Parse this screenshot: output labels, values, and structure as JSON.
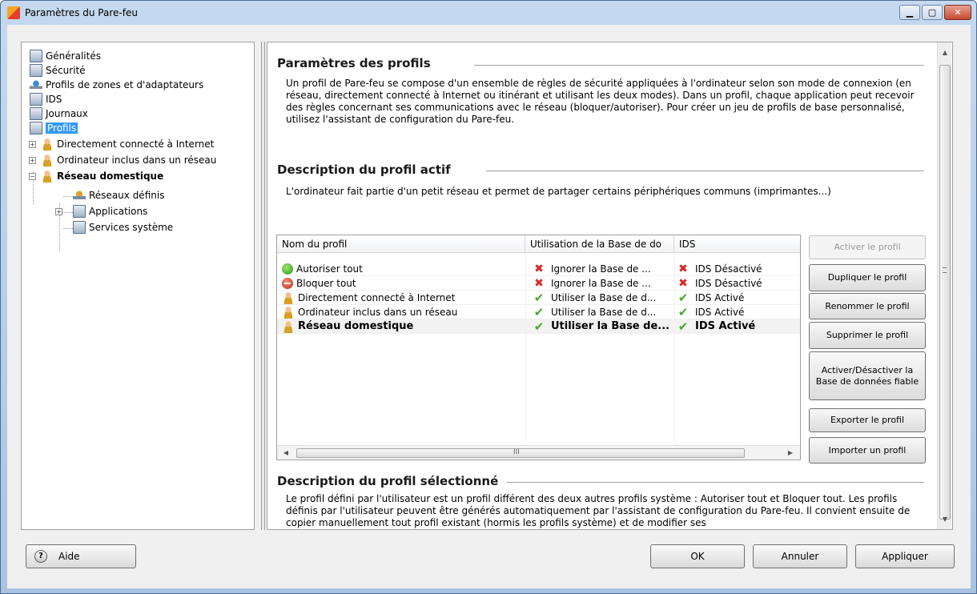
{
  "window": {
    "title": "Paramètres du Pare-feu",
    "minimize_glyph": "▁",
    "maximize_glyph": "▢",
    "close_glyph": "✕"
  },
  "tree": {
    "items": [
      {
        "label": "Généralités",
        "icon": "document-icon"
      },
      {
        "label": "Sécurité",
        "icon": "document-icon"
      },
      {
        "label": "Profils de zones et d'adaptateurs",
        "icon": "network-icon"
      },
      {
        "label": "IDS",
        "icon": "document-icon"
      },
      {
        "label": "Journaux",
        "icon": "document-icon"
      },
      {
        "label": "Profils",
        "icon": "document-icon",
        "selected": true
      },
      {
        "label": "Directement connecté à Internet",
        "icon": "user-icon"
      },
      {
        "label": "Ordinateur inclus dans un réseau",
        "icon": "user-icon"
      },
      {
        "label": "Réseau domestique",
        "icon": "user-icon",
        "bold": true
      },
      {
        "label": "Réseaux définis",
        "icon": "network-warning-icon"
      },
      {
        "label": "Applications",
        "icon": "document-icon"
      },
      {
        "label": "Services système",
        "icon": "document-icon"
      }
    ],
    "expand_plus": "+",
    "expand_minus": "−"
  },
  "main": {
    "profiles_title": "Paramètres des profils",
    "profiles_text": "Un profil de Pare-feu se compose d'un ensemble de règles de sécurité appliquées à l'ordinateur selon son mode de connexion (en réseau, directement connecté à Internet ou itinérant et utilisant les deux modes). Dans un profil, chaque application peut recevoir des règles concernant ses communications avec le réseau (bloquer/autoriser). Pour créer un jeu de profils de base personnalisé, utilisez l'assistant de configuration du Pare-feu.",
    "active_title": "Description du profil actif",
    "active_text": "L'ordinateur fait partie d'un petit réseau et permet de partager certains périphériques communs (imprimantes...)",
    "selected_title": "Description du profil sélectionné",
    "selected_text": "Le profil défini par l'utilisateur est un profil différent des deux autres profils système : Autoriser tout et Bloquer tout. Les profils définis par l'utilisateur peuvent être générés automatiquement par l'assistant de configuration du Pare-feu. Il convient ensuite de copier manuellement tout profil existant (hormis les profils système) et de modifier ses"
  },
  "table": {
    "columns": [
      "Nom du profil",
      "Utilisation de la Base de do",
      "IDS"
    ],
    "rows": [
      {
        "name": "Autoriser tout",
        "icon": "allow-icon",
        "db_status": "ignore",
        "db": "Ignorer la Base de ...",
        "ids_status": "off",
        "ids": "IDS Désactivé",
        "selected": false
      },
      {
        "name": "Bloquer tout",
        "icon": "block-icon",
        "db_status": "ignore",
        "db": "Ignorer la Base de ...",
        "ids_status": "off",
        "ids": "IDS Désactivé",
        "selected": false
      },
      {
        "name": "Directement connecté à Internet",
        "icon": "user-icon",
        "db_status": "use",
        "db": "Utiliser la Base de d...",
        "ids_status": "on",
        "ids": "IDS Activé",
        "selected": false
      },
      {
        "name": "Ordinateur inclus dans un réseau",
        "icon": "user-icon",
        "db_status": "use",
        "db": "Utiliser la Base de d...",
        "ids_status": "on",
        "ids": "IDS Activé",
        "selected": false
      },
      {
        "name": "Réseau domestique",
        "icon": "user-icon",
        "db_status": "use",
        "db": "Utiliser la Base de...",
        "ids_status": "on",
        "ids": "IDS Activé",
        "selected": true
      }
    ],
    "scroll_left": "◀",
    "scroll_right": "▶",
    "scroll_grip": "III"
  },
  "side_buttons": {
    "activate": "Activer le profil",
    "duplicate": "Dupliquer le profil",
    "rename": "Renommer le profil",
    "delete": "Supprimer le profil",
    "toggle_db": "Activer/Désactiver la Base de données fiable",
    "export": "Exporter le profil",
    "import": "Importer un profil"
  },
  "vscroll": {
    "up": "▲",
    "down": "▼"
  },
  "footer": {
    "help": "Aide",
    "help_glyph": "?",
    "ok": "OK",
    "cancel": "Annuler",
    "apply": "Appliquer"
  },
  "glyphs": {
    "x": "✖",
    "check": "✔"
  },
  "colors": {
    "selection": "#3399ff",
    "deny": "#d52a2a",
    "allow": "#4aa72f"
  }
}
